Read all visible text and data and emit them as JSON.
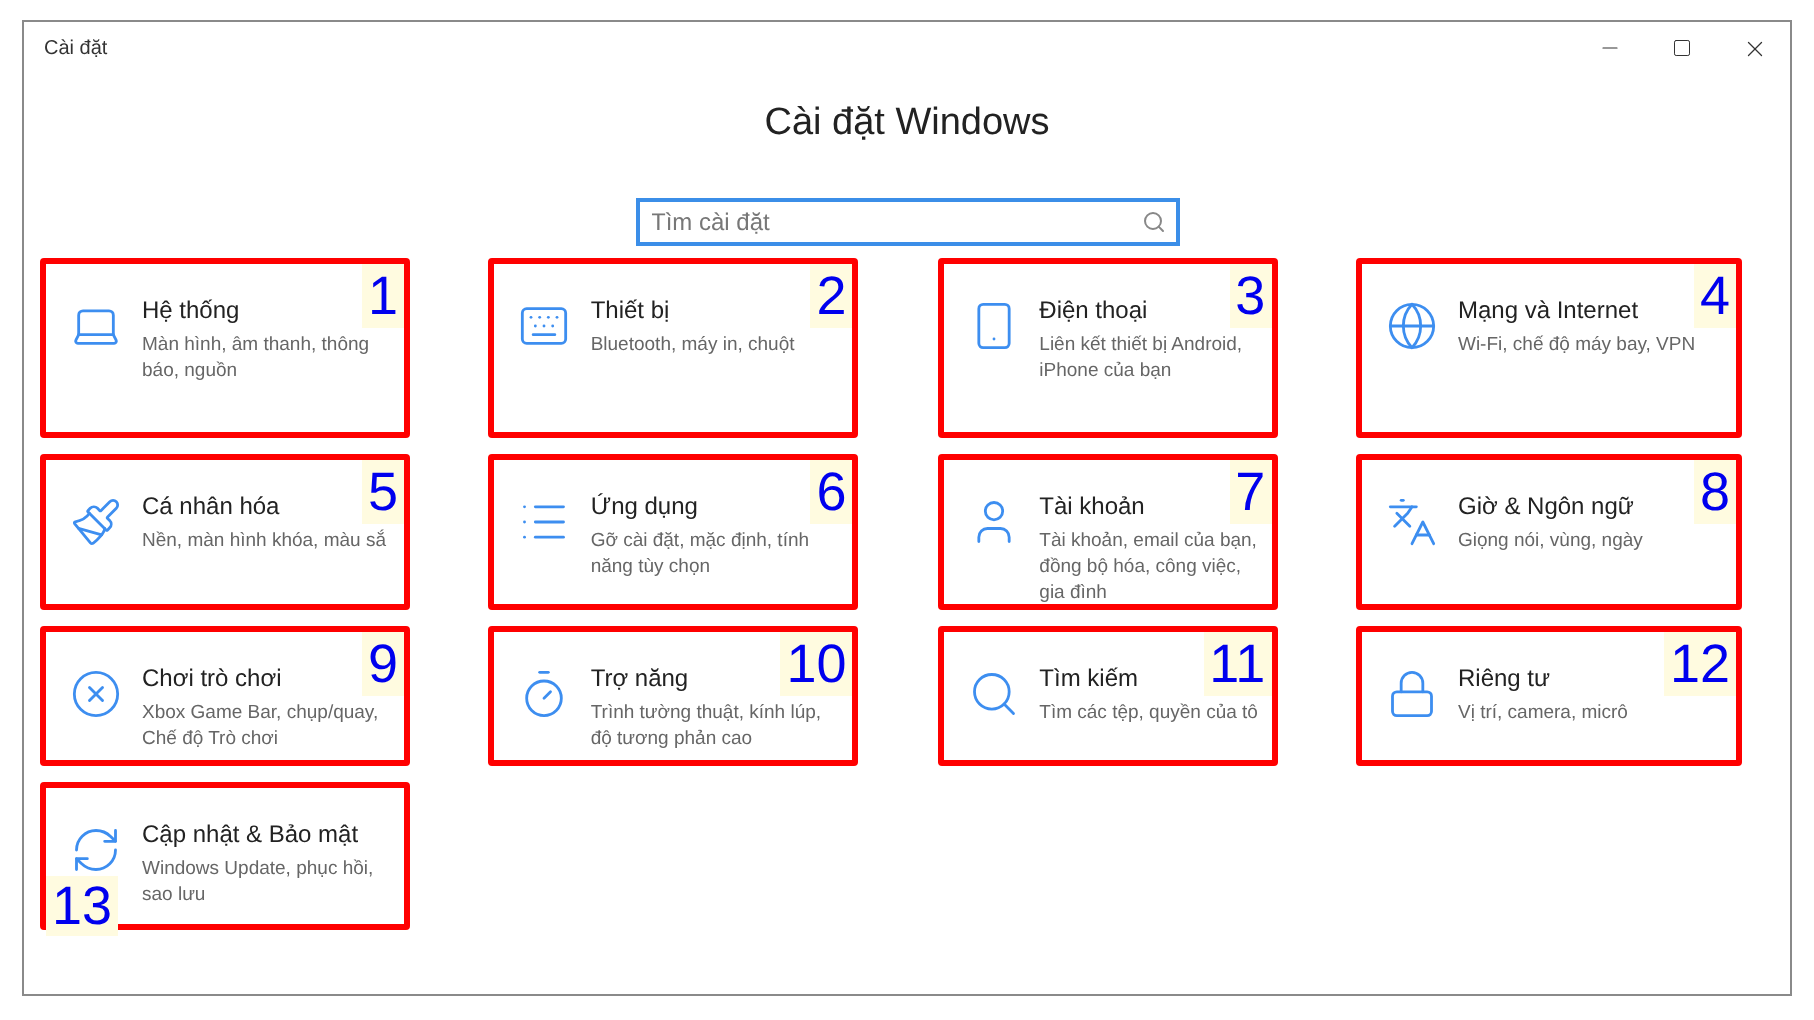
{
  "window": {
    "title": "Cài đặt"
  },
  "heading": "Cài đặt Windows",
  "search": {
    "placeholder": "Tìm cài đặt"
  },
  "tiles": [
    {
      "number": "1",
      "number_below": false,
      "title": "Hệ thống",
      "description": "Màn hình, âm thanh, thông báo, nguồn"
    },
    {
      "number": "2",
      "number_below": false,
      "title": "Thiết bị",
      "description": "Bluetooth, máy in, chuột"
    },
    {
      "number": "3",
      "number_below": false,
      "title": "Điện thoại",
      "description": "Liên kết thiết bị Android, iPhone của bạn"
    },
    {
      "number": "4",
      "number_below": false,
      "title": "Mạng và Internet",
      "description": "Wi-Fi, chế độ máy bay, VPN"
    },
    {
      "number": "5",
      "number_below": false,
      "title": "Cá nhân hóa",
      "description": "Nền, màn hình khóa, màu sắ"
    },
    {
      "number": "6",
      "number_below": false,
      "title": "Ứng dụng",
      "description": "Gỡ cài đặt, mặc định, tính năng tùy chọn"
    },
    {
      "number": "7",
      "number_below": false,
      "title": "Tài khoản",
      "description": "Tài khoản, email của bạn, đồng bộ hóa, công việc, gia đình"
    },
    {
      "number": "8",
      "number_below": false,
      "title": "Giờ & Ngôn ngữ",
      "description": "Giọng nói, vùng, ngày"
    },
    {
      "number": "9",
      "number_below": false,
      "title": "Chơi trò chơi",
      "description": "Xbox Game Bar, chụp/quay, Chế độ Trò chơi"
    },
    {
      "number": "10",
      "number_below": false,
      "title": "Trợ năng",
      "description": "Trình tường thuật, kính lúp, độ tương phản cao"
    },
    {
      "number": "11",
      "number_below": false,
      "title": "Tìm kiếm",
      "description": "Tìm các tệp, quyền của tô"
    },
    {
      "number": "12",
      "number_below": false,
      "title": "Riêng tư",
      "description": "Vị trí, camera, micrô"
    },
    {
      "number": "13",
      "number_below": true,
      "title": "Cập nhật & Bảo mật",
      "description": "Windows Update, phục hồi, sao lưu"
    }
  ]
}
